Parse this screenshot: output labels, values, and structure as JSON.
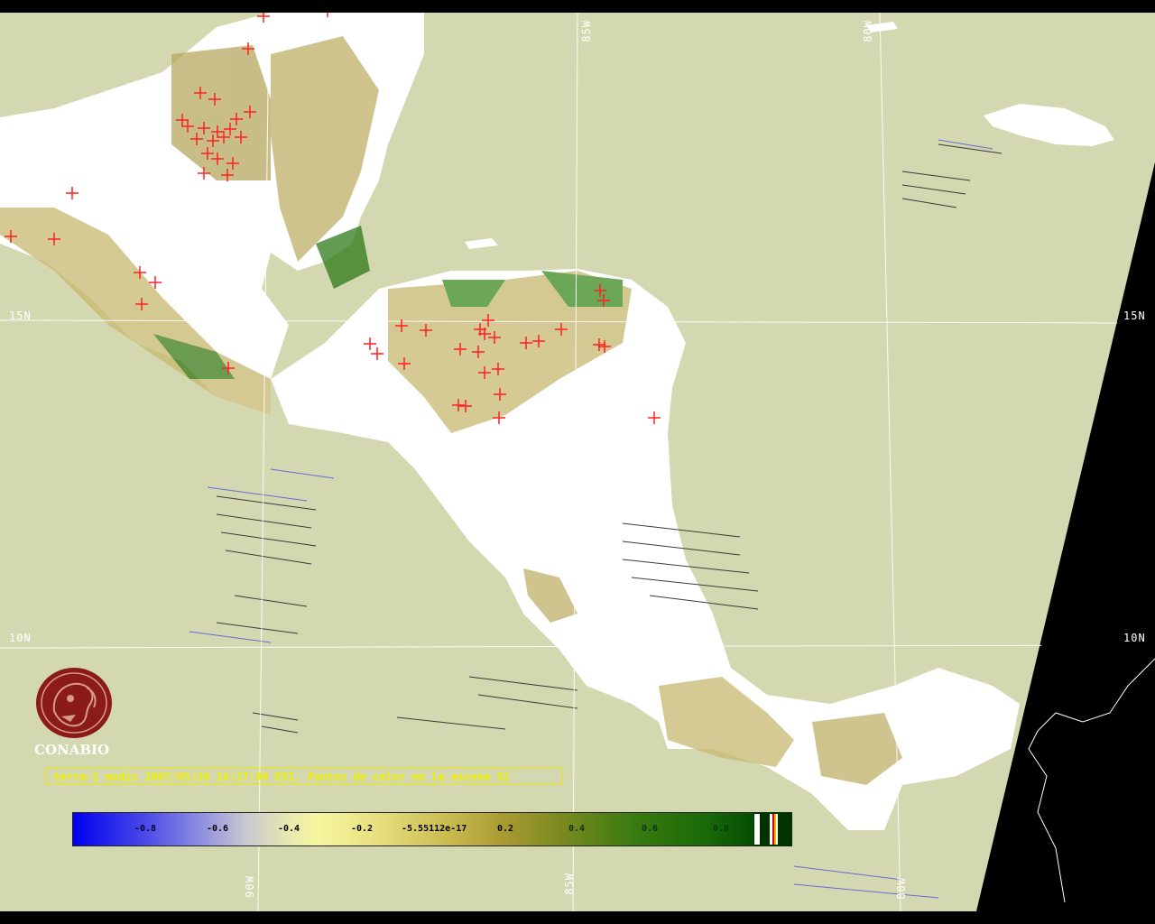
{
  "map": {
    "background_color": "#000000",
    "ocean_color": "#d3d8b1",
    "land_cloud_color": "#ffffff",
    "fire_marker_color": "#ff2020",
    "grid_line_color": "#ffffff",
    "grid_labels": {
      "lat_15_left": "15N",
      "lat_15_right": "15N",
      "lat_10_left": "10N",
      "lat_10_right": "10N",
      "lon_85_top": "85W",
      "lon_80_top": "80W",
      "lon_90_bottom": "90W",
      "lon_85_bottom": "85W",
      "lon_80_bottom": "80W"
    }
  },
  "logo": {
    "name": "CONABIO",
    "color": "#8b1a1a"
  },
  "caption": "terra-1 modis 2007/05/20 16:27:00 EVI, Puntos de calor en la escena 92",
  "colorbar": {
    "ticks": [
      "-0.8",
      "-0.6",
      "-0.4",
      "-0.2",
      "-5.55112e-17",
      "0.2",
      "0.4",
      "0.6",
      "0.8"
    ]
  }
}
